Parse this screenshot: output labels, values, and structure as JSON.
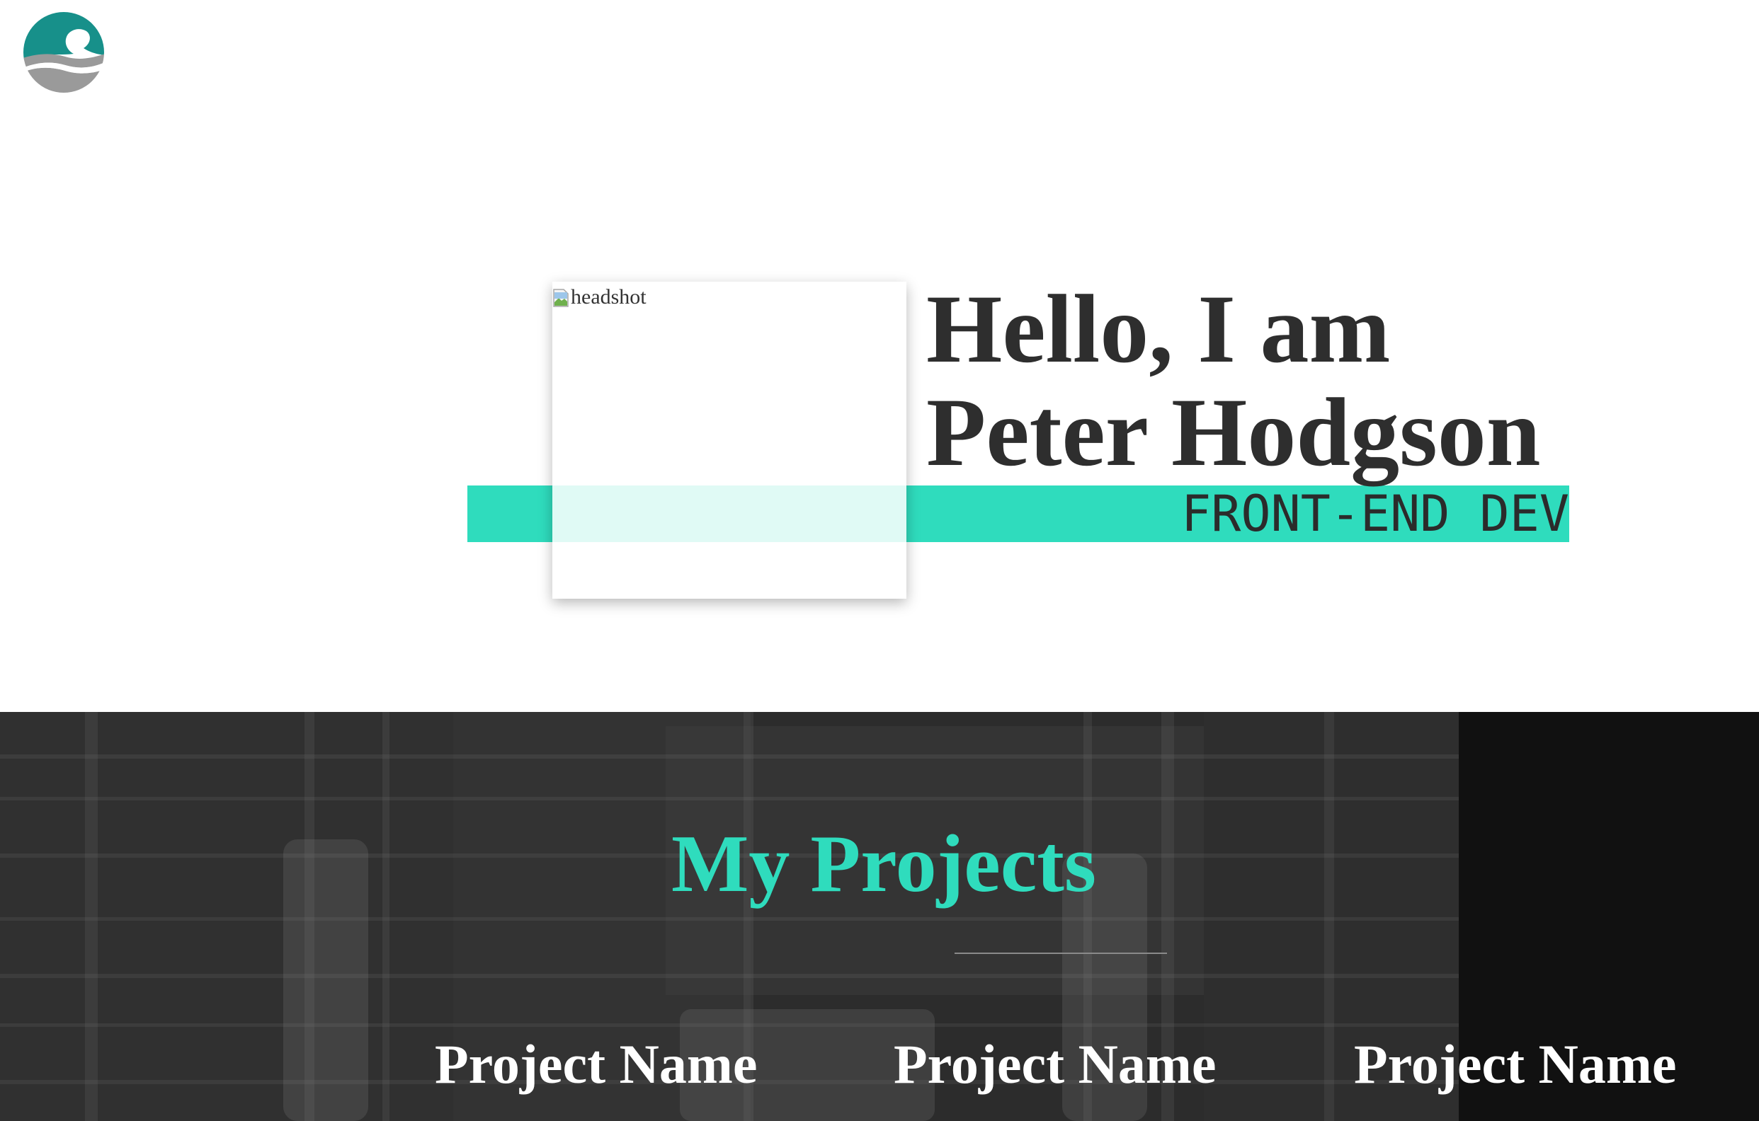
{
  "brand": {
    "logo_icon": "wave-logo-icon",
    "colors": {
      "accent": "#2fdcbd",
      "logo_teal": "#17908a",
      "logo_gray": "#9a9a9a",
      "dark_text": "#2e2e2e",
      "section_bg": "#2d2d2d"
    }
  },
  "hero": {
    "headshot_alt": "headshot",
    "title_line1": "Hello, I am",
    "title_line2": "Peter Hodgson",
    "subtitle": "FRONT-END DEV"
  },
  "projects": {
    "title": "My Projects",
    "items": [
      {
        "name": "Project Name"
      },
      {
        "name": "Project Name"
      },
      {
        "name": "Project Name"
      }
    ]
  }
}
